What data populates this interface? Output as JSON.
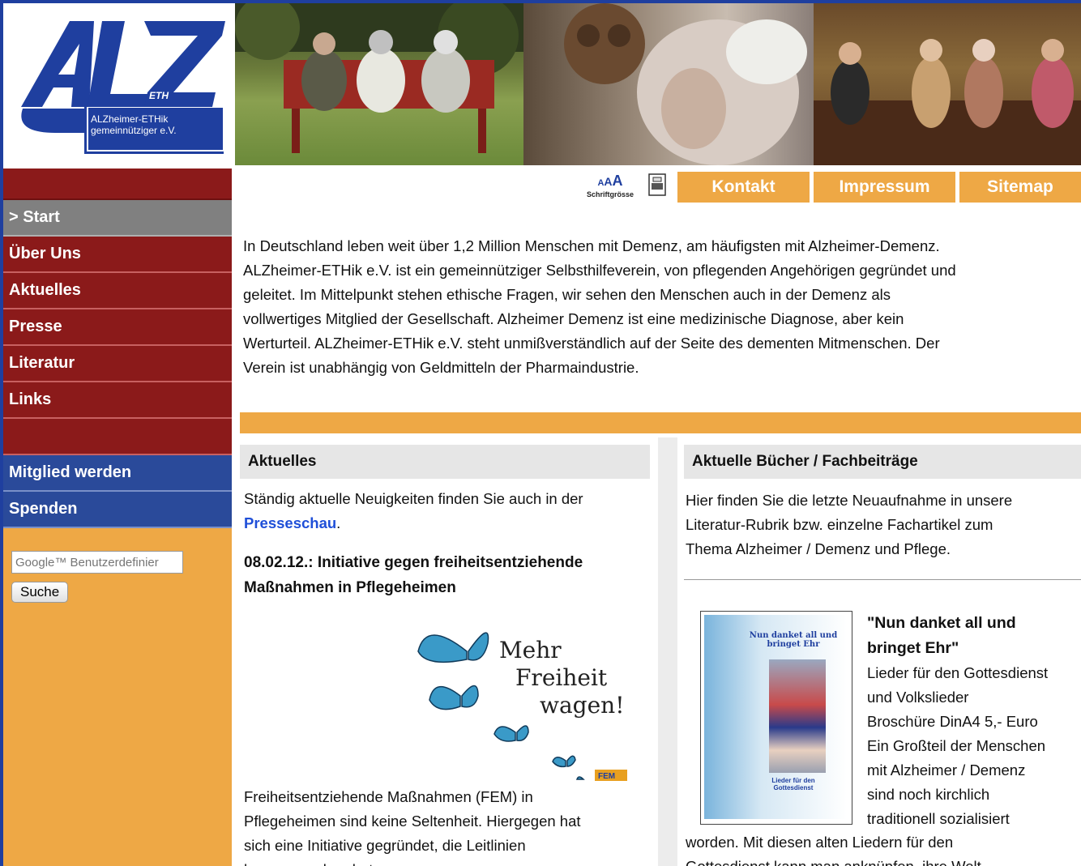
{
  "logo": {
    "line1": "ALZheimer-ETHik",
    "line2": "gemeinnütziger e.V."
  },
  "topnav": {
    "font_size_label": "Schriftgrösse",
    "font_size_glyph": "AAA",
    "print_icon": "printer-icon",
    "tabs": [
      "Kontakt",
      "Impressum",
      "Sitemap"
    ]
  },
  "sidebar": {
    "items": [
      "> Start",
      "Über Uns",
      "Aktuelles",
      "Presse",
      "Literatur",
      "Links"
    ],
    "blue_items": [
      "Mitglied werden",
      "Spenden"
    ],
    "search_placeholder": "Google™ Benutzerdefinier",
    "search_button": "Suche"
  },
  "intro": [
    "In Deutschland leben weit über 1,2 Million Menschen mit Demenz, am häufigsten mit Alzheimer-Demenz.",
    "ALZheimer-ETHik e.V. ist ein gemeinnütziger Selbsthilfeverein, von pflegenden Angehörigen gegründet und",
    "geleitet. Im Mittelpunkt stehen ethische Fragen, wir sehen den Menschen auch in der Demenz als",
    "vollwertiges Mitglied der Gesellschaft. Alzheimer Demenz ist eine medizinische Diagnose, aber kein",
    "Werturteil. ALZheimer-ETHik e.V. steht unmißverständlich auf der Seite des dementen Mitmenschen. Der",
    "Verein ist unabhängig von Geldmitteln der Pharmaindustrie."
  ],
  "news": {
    "heading": "Aktuelles",
    "intro_line1": "Ständig aktuelle Neuigkeiten finden Sie auch in der",
    "intro_link": "Presseschau",
    "intro_end": ".",
    "title_line1": "08.02.12.: Initiative gegen freiheitsentziehende",
    "title_line2": "Maßnahmen in Pflegeheimen",
    "image_text": [
      "Mehr",
      "Freiheit",
      "wagen!"
    ],
    "image_badge": "FEM",
    "body": [
      "Freiheitsentziehende Maßnahmen (FEM) in",
      "Pflegeheimen sind keine Seltenheit. Hiergegen hat",
      "sich eine Initiative gegründet, die Leitlinien",
      "herausgegeben hat."
    ]
  },
  "books": {
    "heading": "Aktuelle Bücher / Fachbeiträge",
    "intro": [
      "Hier finden Sie die letzte Neuaufnahme in unsere",
      "Literatur-Rubrik bzw. einzelne Fachartikel zum",
      "Thema Alzheimer / Demenz und Pflege."
    ],
    "cover_title": "Nun danket all und bringet Ehr",
    "cover_sub": "Lieder für den Gottesdienst",
    "title_line1": "\"Nun danket all und",
    "title_line2": "bringet Ehr\"",
    "desc": [
      "Lieder für den Gottesdienst",
      "und Volkslieder",
      "Broschüre DinA4 5,- Euro",
      "Ein Großteil der Menschen",
      "mit Alzheimer / Demenz",
      "sind noch kirchlich",
      "traditionell sozialisiert"
    ],
    "cont": [
      "worden. Mit diesen alten Liedern für den",
      "Gottesdienst kann man anknüpfen, ihre Welt"
    ]
  },
  "colors": {
    "frame_blue": "#1f3f9f",
    "nav_red": "#8b1a1a",
    "orange": "#eea845",
    "nav_blue": "#2a4a9a"
  }
}
